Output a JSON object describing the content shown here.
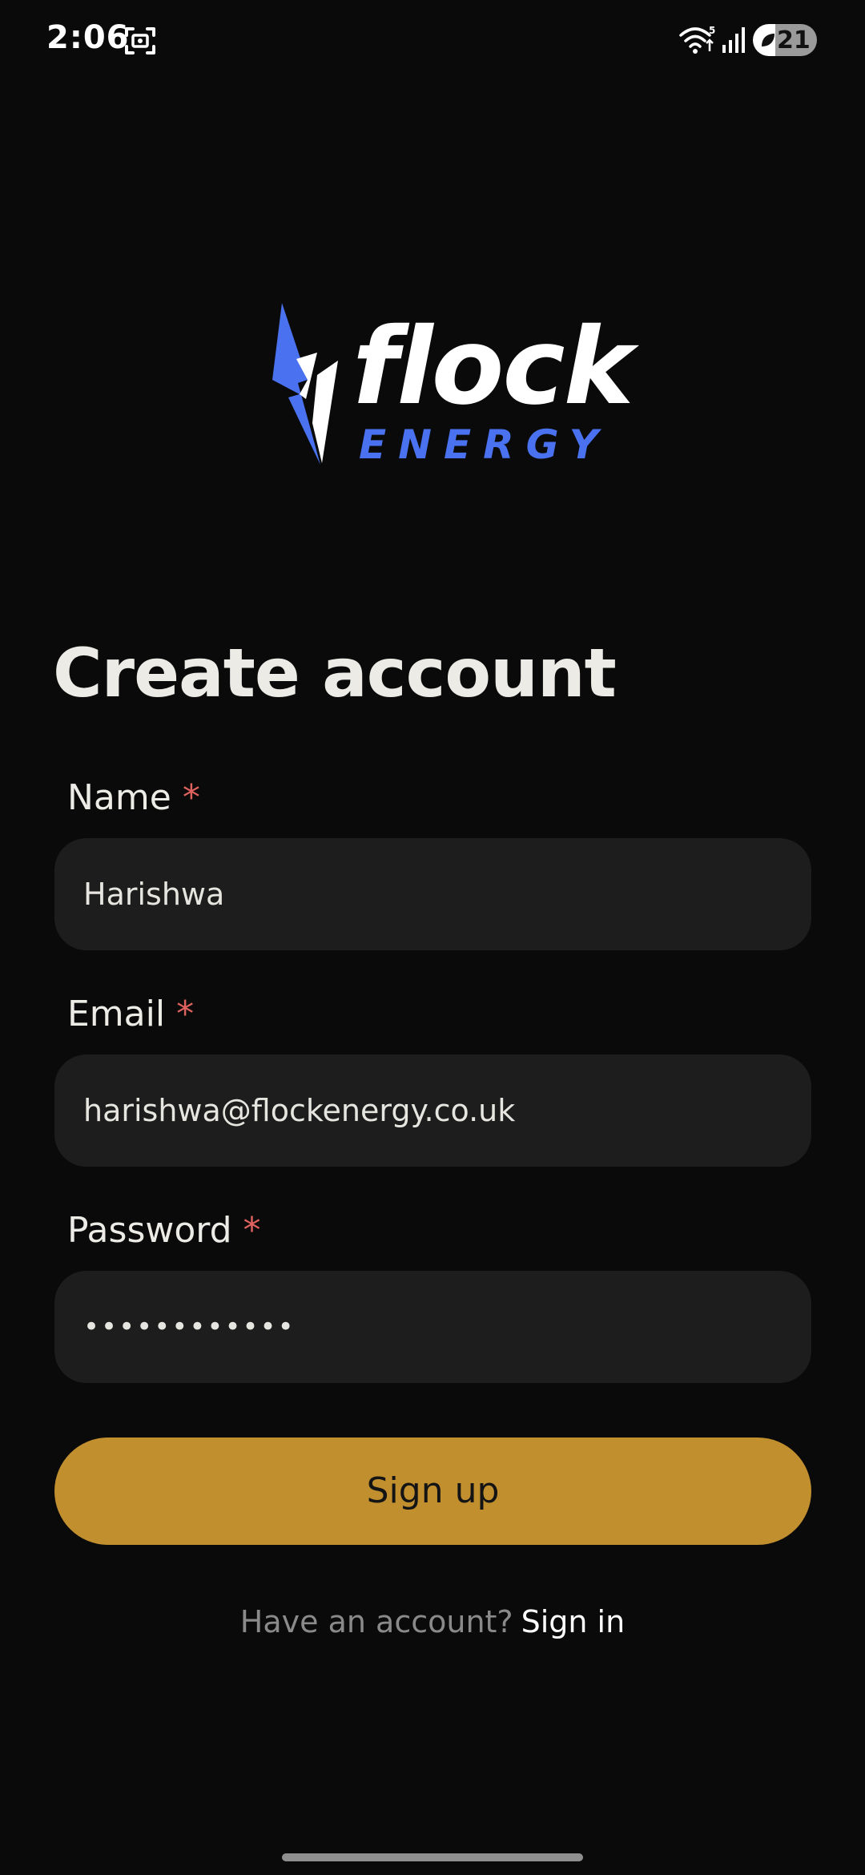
{
  "status_bar": {
    "time": "2:06",
    "battery_level": "21",
    "icons": [
      "screenshot-icon",
      "wifi-icon",
      "signal-icon",
      "battery-saver-icon"
    ]
  },
  "logo": {
    "word": "flock",
    "sub": "ENERGY",
    "colors": {
      "bolt": "#4a72f0",
      "word": "#ffffff",
      "sub": "#4a72f0"
    }
  },
  "page": {
    "title": "Create account"
  },
  "form": {
    "required_marker": "*",
    "name": {
      "label": "Name",
      "value": "Harishwa"
    },
    "email": {
      "label": "Email",
      "value": "harishwa@flockenergy.co.uk"
    },
    "password": {
      "label": "Password",
      "value": "••••••••••••"
    }
  },
  "actions": {
    "signup_label": "Sign up",
    "have_account": "Have an account?",
    "signin_label": "Sign in"
  },
  "colors": {
    "background": "#0a0a0a",
    "field": "#1d1d1d",
    "accent": "#c28f2f",
    "required": "#e0625e"
  }
}
